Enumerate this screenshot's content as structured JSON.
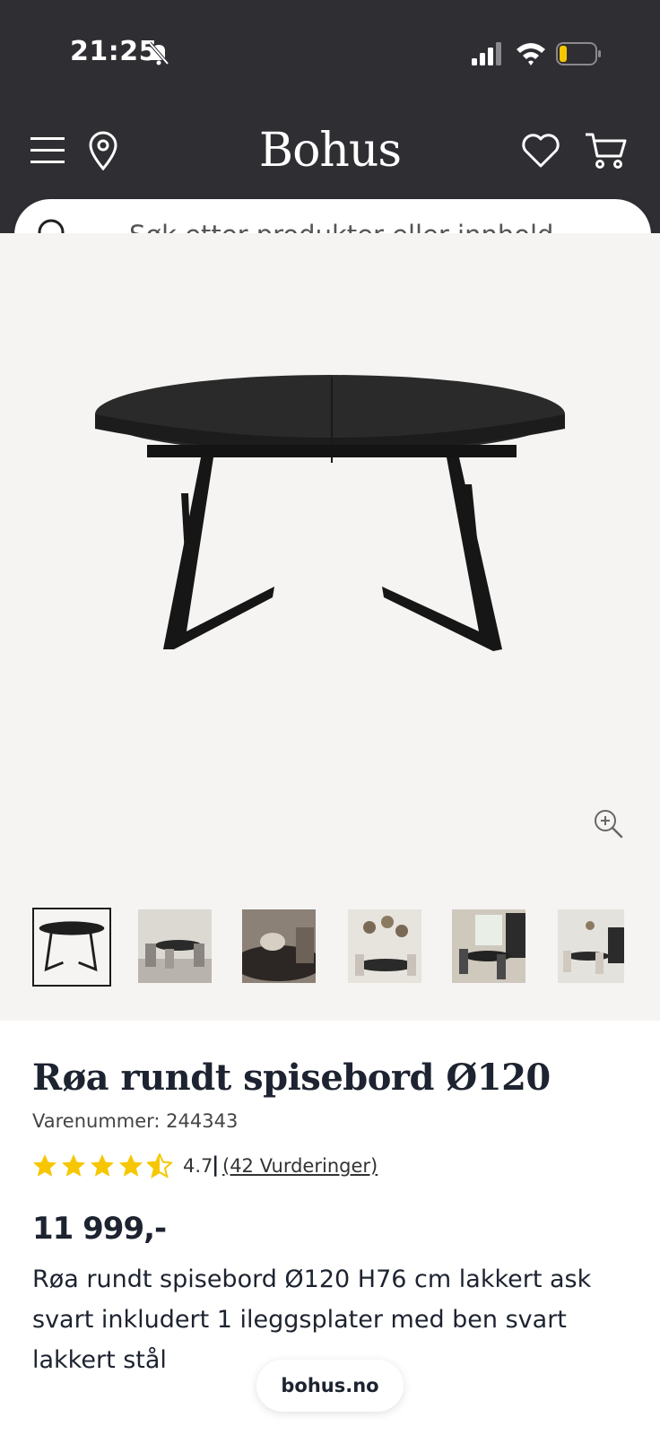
{
  "status_bar": {
    "time": "21:25"
  },
  "header": {
    "logo": "Bohus",
    "search_placeholder": "Søk etter produkter eller innhold ..."
  },
  "gallery": {
    "thumbnail_count": 6,
    "active_index": 0
  },
  "product": {
    "title": "Røa rundt spisebord Ø120",
    "sku": "Varenummer: 244343",
    "rating_value": "4.7",
    "rating_stars": 4.7,
    "rating_separator": "|",
    "rating_link": "(42 Vurderinger)",
    "price": "11 999,-",
    "description": "Røa rundt spisebord Ø120 H76 cm lakkert ask svart inkludert 1 ileggsplater med ben svart lakkert stål"
  },
  "footer": {
    "site": "bohus.no"
  },
  "colors": {
    "header_bg": "#2f2e33",
    "star": "#f6c700",
    "text": "#1d2330",
    "gallery_bg": "#f5f4f2"
  }
}
